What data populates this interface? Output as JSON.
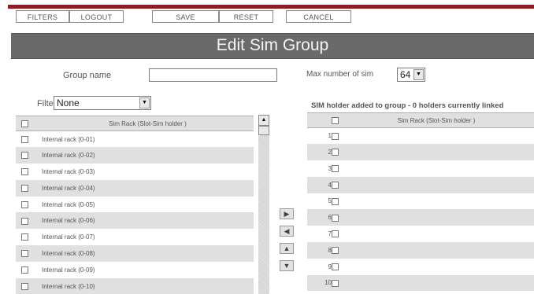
{
  "toolbar": {
    "filters": "FILTERS",
    "logout": "LOGOUT",
    "save": "SAVE",
    "reset": "RESET",
    "cancel": "CANCEL"
  },
  "page_title": "Edit Sim Group",
  "form": {
    "group_name_label": "Group name",
    "group_name_value": "",
    "max_sim_label": "Max number of sim",
    "max_sim_value": "64",
    "filter_label": "Filter",
    "filter_value": "None"
  },
  "left_table": {
    "header": "Sim Rack (Slot-Sim holder )",
    "rows": [
      "Internal rack (0-01)",
      "Internal rack (0-02)",
      "Internal rack (0-03)",
      "Internal rack (0-04)",
      "Internal rack (0-05)",
      "Internal rack (0-06)",
      "Internal rack (0-07)",
      "Internal rack (0-08)",
      "Internal rack (0-09)",
      "Internal rack (0-10)"
    ]
  },
  "right_panel": {
    "title": "SIM holder added to group - 0 holders currently linked",
    "header": "Sim Rack (Slot-Sim holder )",
    "rows": [
      "1",
      "2",
      "3",
      "4",
      "5",
      "6",
      "7",
      "8",
      "9",
      "10"
    ]
  },
  "icons": {
    "move_right": "arrow-right-icon",
    "move_left": "arrow-left-icon",
    "move_up": "arrow-up-icon",
    "move_down": "arrow-down-icon"
  },
  "colors": {
    "brand": "#8e1d25",
    "title_bar": "#6a6a6a",
    "row_alt": "#e0e0e0"
  }
}
